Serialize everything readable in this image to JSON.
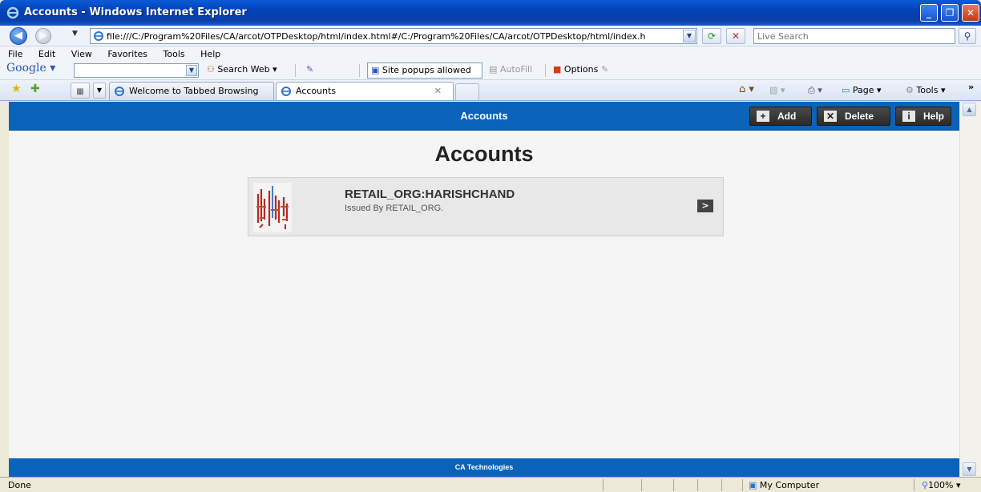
{
  "window": {
    "title": "Accounts - Windows Internet Explorer",
    "min_label": "_",
    "max_label": "❐",
    "close_label": "✕"
  },
  "addressbar": {
    "url": "file:///C:/Program%20Files/CA/arcot/OTPDesktop/html/index.html#/C:/Program%20Files/CA/arcot/OTPDesktop/html/index.h",
    "search_placeholder": "Live Search"
  },
  "menu": {
    "items": [
      "File",
      "Edit",
      "View",
      "Favorites",
      "Tools",
      "Help"
    ]
  },
  "google_toolbar": {
    "brand": "Google",
    "search_web": "Search Web",
    "popups": "Site popups allowed",
    "autofill": "AutoFill",
    "options": "Options"
  },
  "tabs": [
    {
      "label": "Welcome to Tabbed Browsing",
      "active": false
    },
    {
      "label": "Accounts",
      "active": true
    }
  ],
  "command_bar": {
    "page": "Page",
    "tools": "Tools"
  },
  "app": {
    "header_title": "Accounts",
    "add_label": "Add",
    "delete_label": "Delete",
    "help_label": "Help",
    "page_title": "Accounts",
    "accounts": [
      {
        "name": "RETAIL_ORG:HARISHCHAND",
        "issued_by": "Issued By RETAIL_ORG."
      }
    ],
    "footer": "CA Technologies"
  },
  "statusbar": {
    "status": "Done",
    "zone": "My Computer",
    "zoom": "100%"
  },
  "colors": {
    "app_blue": "#0a63b8",
    "button_dark": "#333333"
  }
}
